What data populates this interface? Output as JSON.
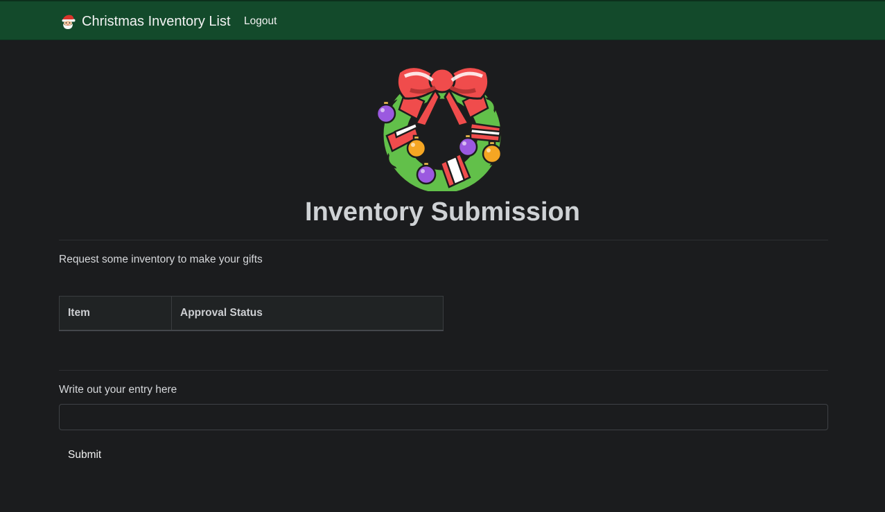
{
  "navbar": {
    "brand_icon": "santa-emoji-icon",
    "brand_label": "Christmas Inventory List",
    "logout_label": "Logout"
  },
  "hero": {
    "image": "christmas-wreath-icon"
  },
  "page": {
    "title": "Inventory Submission",
    "intro": "Request some inventory to make your gifts"
  },
  "table": {
    "columns": [
      "Item",
      "Approval Status"
    ],
    "rows": []
  },
  "form": {
    "entry_label": "Write out your entry here",
    "entry_value": "",
    "submit_label": "Submit"
  },
  "colors": {
    "navbar_bg": "#134a2b",
    "page_bg": "#1b1c1e",
    "table_header_bg": "#202324"
  }
}
